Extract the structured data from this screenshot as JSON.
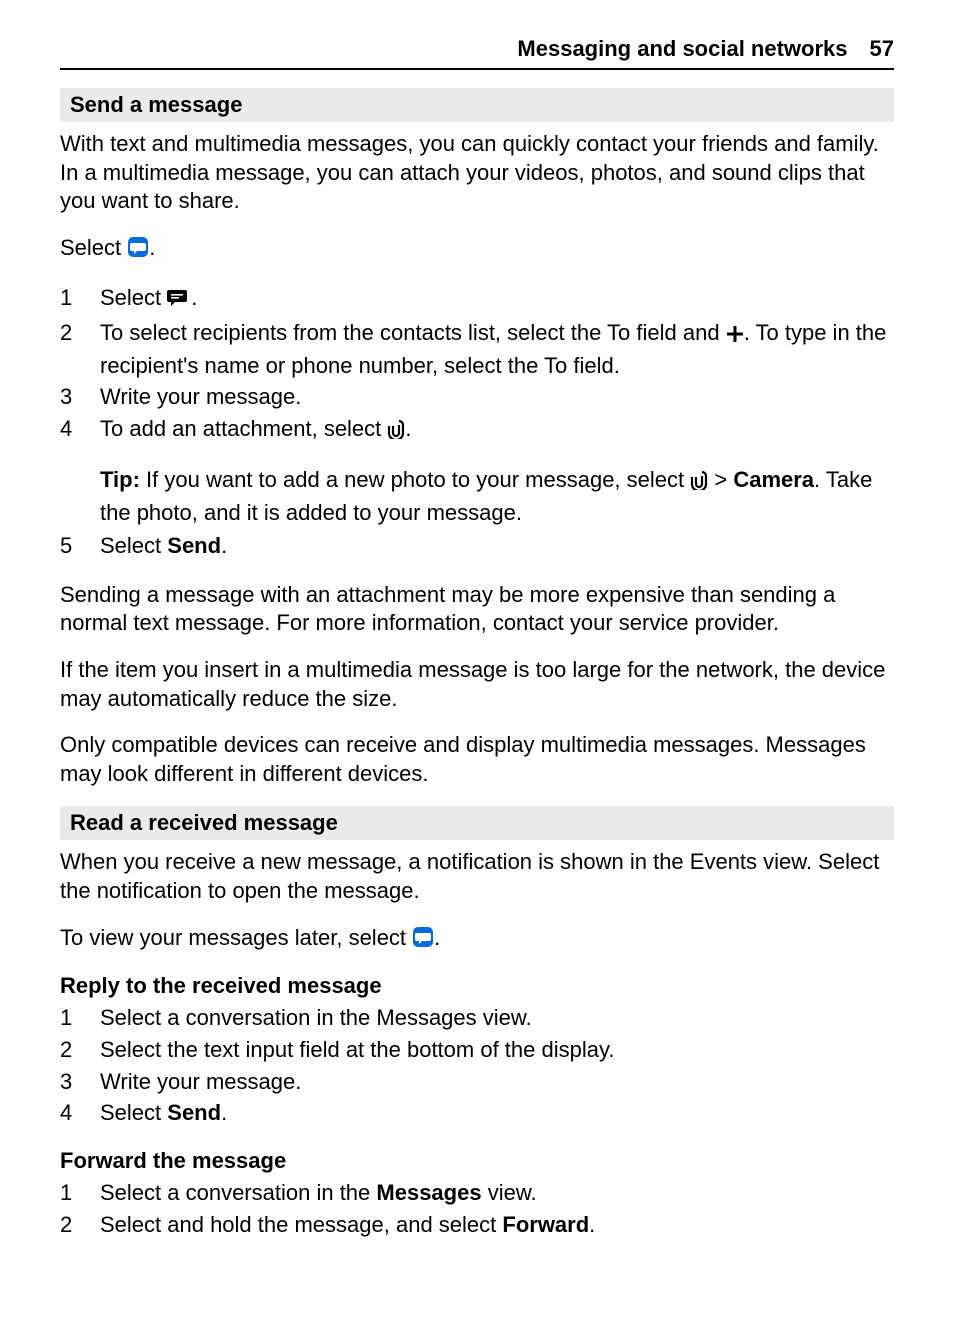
{
  "header": {
    "title": "Messaging and social networks",
    "page": "57"
  },
  "section1": {
    "heading": "Send a message",
    "intro": "With text and multimedia messages, you can quickly contact your friends and family. In a multimedia message, you can attach your videos, photos, and sound clips that you want to share.",
    "select_prefix": "Select ",
    "period": ".",
    "steps": {
      "s1_prefix": "Select ",
      "s2_a": "To select recipients from the contacts list, select the To field and ",
      "s2_b": ". To type in the recipient's name or phone number, select the To field.",
      "s3": "Write your message.",
      "s4_a": "To add an attachment, select ",
      "tip_label": "Tip:",
      "tip_a": " If you want to add a new photo to your message, select ",
      "tip_gt": " > ",
      "tip_camera": "Camera",
      "tip_b": ". Take the photo, and it is added to your message.",
      "s5_a": "Select ",
      "s5_b": "Send",
      "s5_c": "."
    },
    "para2": "Sending a message with an attachment may be more expensive than sending a normal text message. For more information, contact your service provider.",
    "para3": "If the item you insert in a multimedia message is too large for the network, the device may automatically reduce the size.",
    "para4": "Only compatible devices can receive and display multimedia messages. Messages may look different in different devices."
  },
  "section2": {
    "heading": "Read a received message",
    "intro": "When you receive a new message, a notification is shown in the Events view. Select the notification to open the message.",
    "view_later_a": "To view your messages later, select ",
    "view_later_b": ".",
    "reply_heading": "Reply to the received message",
    "reply_steps": {
      "r1": "Select a conversation in the Messages view.",
      "r2": "Select the text input field at the bottom of the display.",
      "r3": "Write your message.",
      "r4_a": "Select ",
      "r4_b": "Send",
      "r4_c": "."
    },
    "forward_heading": "Forward the message",
    "forward_steps": {
      "f1_a": "Select a conversation in the ",
      "f1_b": "Messages",
      "f1_c": " view.",
      "f2_a": "Select and hold the message, and select ",
      "f2_b": "Forward",
      "f2_c": "."
    }
  }
}
